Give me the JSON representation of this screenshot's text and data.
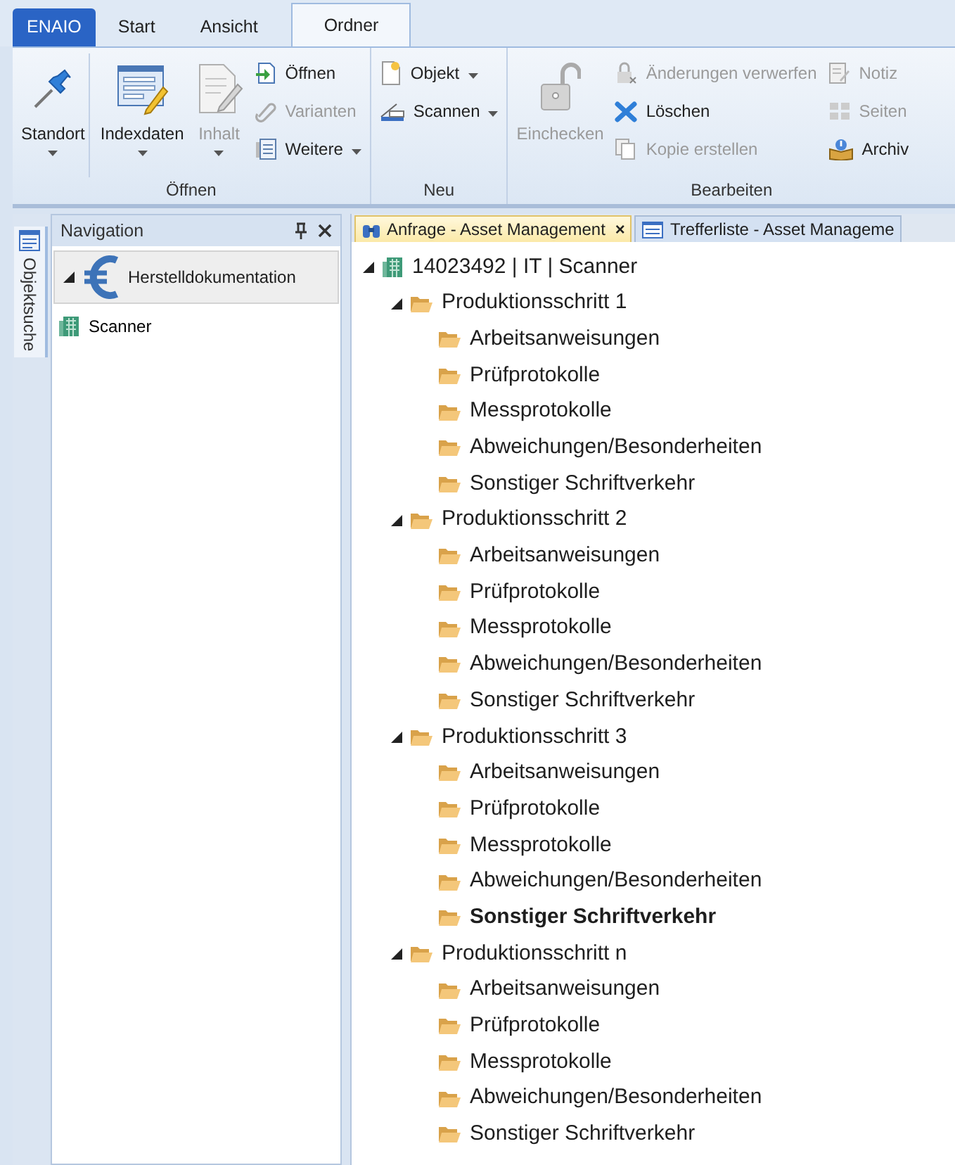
{
  "app_tabs": [
    {
      "label": "ENAIO",
      "kind": "app",
      "selected": false
    },
    {
      "label": "Start",
      "kind": "tab",
      "selected": false
    },
    {
      "label": "Ansicht",
      "kind": "tab",
      "selected": false
    },
    {
      "label": "Ordner",
      "kind": "tab",
      "selected": true
    }
  ],
  "ribbon": {
    "groups": [
      {
        "label": "Öffnen",
        "items": [
          {
            "label": "Standort",
            "kind": "large",
            "disabled": false,
            "dropdown": true,
            "separator_after": true
          },
          {
            "label": "Indexdaten",
            "kind": "large",
            "disabled": false,
            "dropdown": true
          },
          {
            "label": "Inhalt",
            "kind": "large",
            "disabled": true,
            "dropdown": true
          },
          {
            "kind": "column",
            "items": [
              {
                "label": "Öffnen",
                "disabled": false,
                "dropdown": false
              },
              {
                "label": "Varianten",
                "disabled": true,
                "dropdown": false
              },
              {
                "label": "Weitere",
                "disabled": false,
                "dropdown": true
              }
            ]
          }
        ]
      },
      {
        "label": "Neu",
        "items": [
          {
            "kind": "column",
            "items": [
              {
                "label": "Objekt",
                "disabled": false,
                "dropdown": true
              },
              {
                "label": "Scannen",
                "disabled": false,
                "dropdown": true
              }
            ]
          }
        ]
      },
      {
        "label": "Bearbeiten",
        "items": [
          {
            "label": "Einchecken",
            "kind": "large",
            "disabled": true,
            "dropdown": false
          },
          {
            "kind": "column",
            "items": [
              {
                "label": "Änderungen verwerfen",
                "disabled": true,
                "dropdown": false
              },
              {
                "label": "Löschen",
                "disabled": false,
                "dropdown": false
              },
              {
                "label": "Kopie erstellen",
                "disabled": true,
                "dropdown": false
              }
            ]
          },
          {
            "kind": "column",
            "items": [
              {
                "label": "Notiz",
                "disabled": true,
                "dropdown": false
              },
              {
                "label": "Seiten",
                "disabled": true,
                "dropdown": false
              },
              {
                "label": "Archiv",
                "disabled": false,
                "dropdown": false
              }
            ]
          }
        ]
      }
    ]
  },
  "side_strip": {
    "label": "Objektsuche"
  },
  "navigation": {
    "title": "Navigation",
    "items": [
      {
        "label": "Herstelldokumentation",
        "kind": "header",
        "expanded": true
      },
      {
        "label": "Scanner",
        "kind": "item"
      }
    ]
  },
  "document_tabs": [
    {
      "label": "Anfrage - Asset Management",
      "kind": "query",
      "selected": true,
      "close": "×"
    },
    {
      "label": "Trefferliste - Asset Manageme",
      "kind": "results",
      "selected": false
    }
  ],
  "tree": {
    "label": "14023492 | IT | Scanner",
    "kind": "record",
    "expanded": true,
    "selected": false,
    "children": [
      {
        "label": "Produktionsschritt 1",
        "kind": "folder",
        "expanded": true,
        "selected": false,
        "children": [
          {
            "label": "Arbeitsanweisungen",
            "kind": "folder",
            "selected": false
          },
          {
            "label": "Prüfprotokolle",
            "kind": "folder",
            "selected": false
          },
          {
            "label": "Messprotokolle",
            "kind": "folder",
            "selected": false
          },
          {
            "label": "Abweichungen/Besonderheiten",
            "kind": "folder",
            "selected": false
          },
          {
            "label": "Sonstiger Schriftverkehr",
            "kind": "folder",
            "selected": false
          }
        ]
      },
      {
        "label": "Produktionsschritt 2",
        "kind": "folder",
        "expanded": true,
        "selected": false,
        "children": [
          {
            "label": "Arbeitsanweisungen",
            "kind": "folder",
            "selected": false
          },
          {
            "label": "Prüfprotokolle",
            "kind": "folder",
            "selected": false
          },
          {
            "label": "Messprotokolle",
            "kind": "folder",
            "selected": false
          },
          {
            "label": "Abweichungen/Besonderheiten",
            "kind": "folder",
            "selected": false
          },
          {
            "label": "Sonstiger Schriftverkehr",
            "kind": "folder",
            "selected": false
          }
        ]
      },
      {
        "label": "Produktionsschritt 3",
        "kind": "folder",
        "expanded": true,
        "selected": false,
        "children": [
          {
            "label": "Arbeitsanweisungen",
            "kind": "folder",
            "selected": false
          },
          {
            "label": "Prüfprotokolle",
            "kind": "folder",
            "selected": false
          },
          {
            "label": "Messprotokolle",
            "kind": "folder",
            "selected": false
          },
          {
            "label": "Abweichungen/Besonderheiten",
            "kind": "folder",
            "selected": false
          },
          {
            "label": "Sonstiger Schriftverkehr",
            "kind": "folder",
            "selected": true
          }
        ]
      },
      {
        "label": "Produktionsschritt n",
        "kind": "folder",
        "expanded": true,
        "selected": false,
        "children": [
          {
            "label": "Arbeitsanweisungen",
            "kind": "folder",
            "selected": false
          },
          {
            "label": "Prüfprotokolle",
            "kind": "folder",
            "selected": false
          },
          {
            "label": "Messprotokolle",
            "kind": "folder",
            "selected": false
          },
          {
            "label": "Abweichungen/Besonderheiten",
            "kind": "folder",
            "selected": false
          },
          {
            "label": "Sonstiger Schriftverkehr",
            "kind": "folder",
            "selected": false
          }
        ]
      }
    ]
  }
}
